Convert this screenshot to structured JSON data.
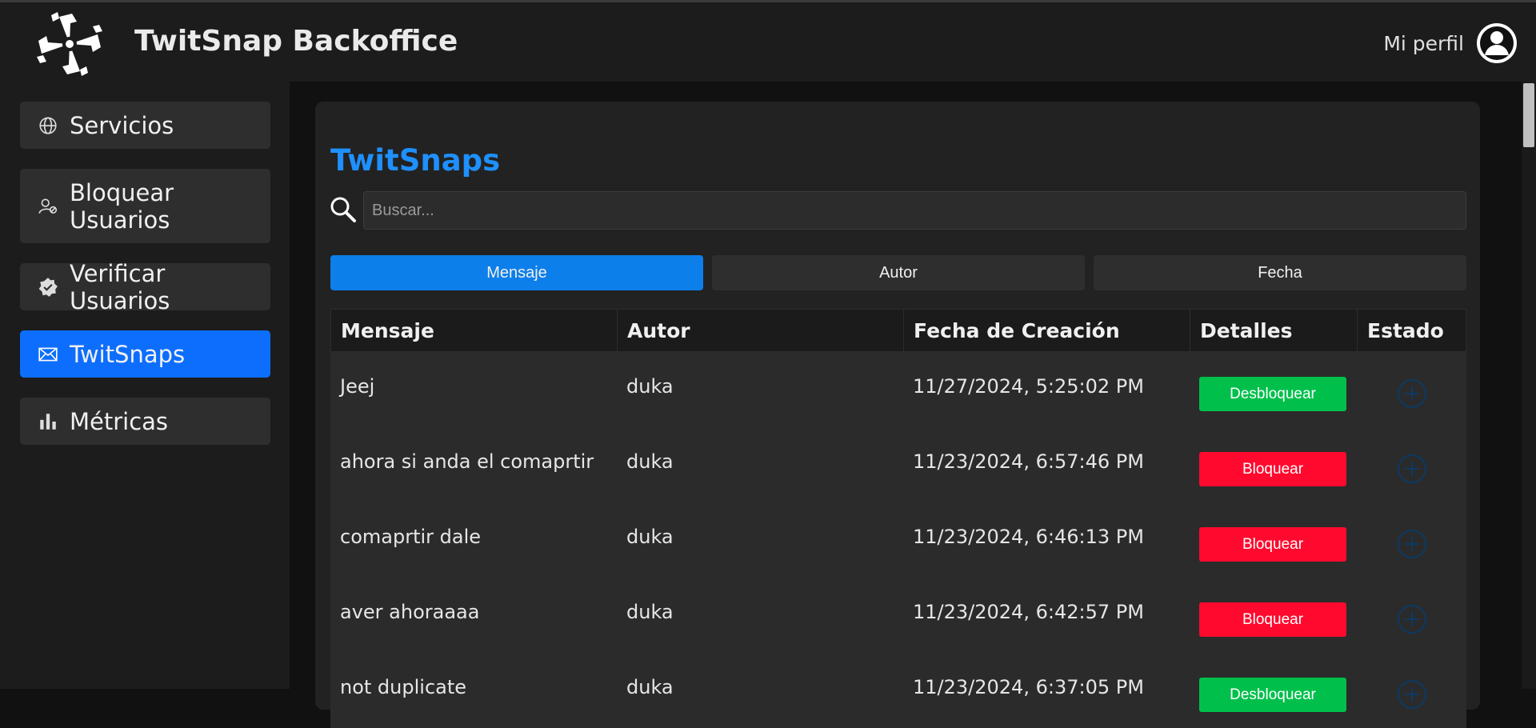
{
  "header": {
    "title": "TwitSnap Backoffice",
    "logo_icon": "pinwheel-logo-icon",
    "profile_label": "Mi perfil",
    "avatar_icon": "user-circle-icon"
  },
  "sidebar": {
    "items": [
      {
        "label": "Servicios",
        "icon": "globe-icon",
        "active": false
      },
      {
        "label": "Bloquear Usuarios",
        "icon": "user-block-icon",
        "active": false
      },
      {
        "label": "Verificar Usuarios",
        "icon": "verified-badge-icon",
        "active": false
      },
      {
        "label": "TwitSnaps",
        "icon": "envelope-icon",
        "active": true
      },
      {
        "label": "Métricas",
        "icon": "bar-chart-icon",
        "active": false
      }
    ]
  },
  "main": {
    "title": "TwitSnaps",
    "search": {
      "placeholder": "Buscar...",
      "value": "",
      "icon": "search-icon"
    },
    "filters": [
      {
        "label": "Mensaje",
        "active": true
      },
      {
        "label": "Autor",
        "active": false
      },
      {
        "label": "Fecha",
        "active": false
      }
    ],
    "table": {
      "headers": [
        "Mensaje",
        "Autor",
        "Fecha de Creación",
        "Detalles",
        "Estado"
      ],
      "rows": [
        {
          "message": "Jeej",
          "author": "duka",
          "date": "11/27/2024, 5:25:02 PM",
          "action": "Desbloquear",
          "action_color": "#00c04b"
        },
        {
          "message": "ahora si anda el comaprtir",
          "author": "duka",
          "date": "11/23/2024, 6:57:46 PM",
          "action": "Bloquear",
          "action_color": "#ff0a2e"
        },
        {
          "message": "comaprtir dale",
          "author": "duka",
          "date": "11/23/2024, 6:46:13 PM",
          "action": "Bloquear",
          "action_color": "#ff0a2e"
        },
        {
          "message": "aver ahoraaaa",
          "author": "duka",
          "date": "11/23/2024, 6:42:57 PM",
          "action": "Bloquear",
          "action_color": "#ff0a2e"
        },
        {
          "message": "not duplicate",
          "author": "duka",
          "date": "11/23/2024, 6:37:05 PM",
          "action": "Desbloquear",
          "action_color": "#00c04b"
        }
      ],
      "details_icon": "plus-circle-icon"
    }
  },
  "colors": {
    "accent": "#1e90ff",
    "active_nav": "#0d6efd",
    "unblock": "#00c04b",
    "block": "#ff0a2e"
  }
}
